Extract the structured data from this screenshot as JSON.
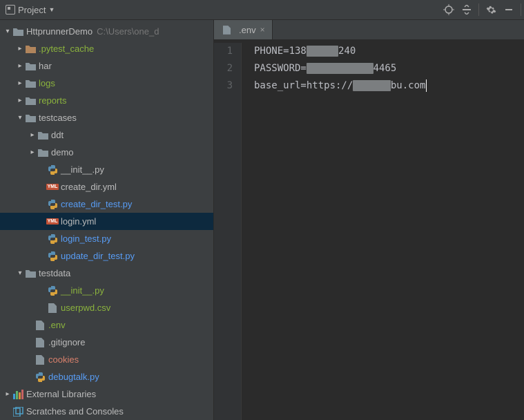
{
  "toolbar": {
    "project_label": "Project"
  },
  "tab": {
    "name": ".env"
  },
  "tree": {
    "root": {
      "name": "HttprunnerDemo",
      "path": "C:\\Users\\one_d"
    },
    "pytest_cache": ".pytest_cache",
    "har": "har",
    "logs": "logs",
    "reports": "reports",
    "testcases": "testcases",
    "ddt": "ddt",
    "demo": "demo",
    "init_py": "__init__.py",
    "create_dir_yml": "create_dir.yml",
    "create_dir_test_py": "create_dir_test.py",
    "login_yml": "login.yml",
    "login_test_py": "login_test.py",
    "update_dir_test_py": "update_dir_test.py",
    "testdata": "testdata",
    "init_py2": "__init__.py",
    "userpwd_csv": "userpwd.csv",
    "env": ".env",
    "gitignore": ".gitignore",
    "cookies": "cookies",
    "debugtalk": "debugtalk.py",
    "external": "External Libraries",
    "scratches": "Scratches and Consoles"
  },
  "editor": {
    "line1": {
      "pre": "PHONE=138",
      "post": "240"
    },
    "line2": {
      "pre": "PASSWORD=",
      "post": "4465"
    },
    "line3": {
      "pre": "base_url=https://",
      "post": "bu.com"
    }
  }
}
